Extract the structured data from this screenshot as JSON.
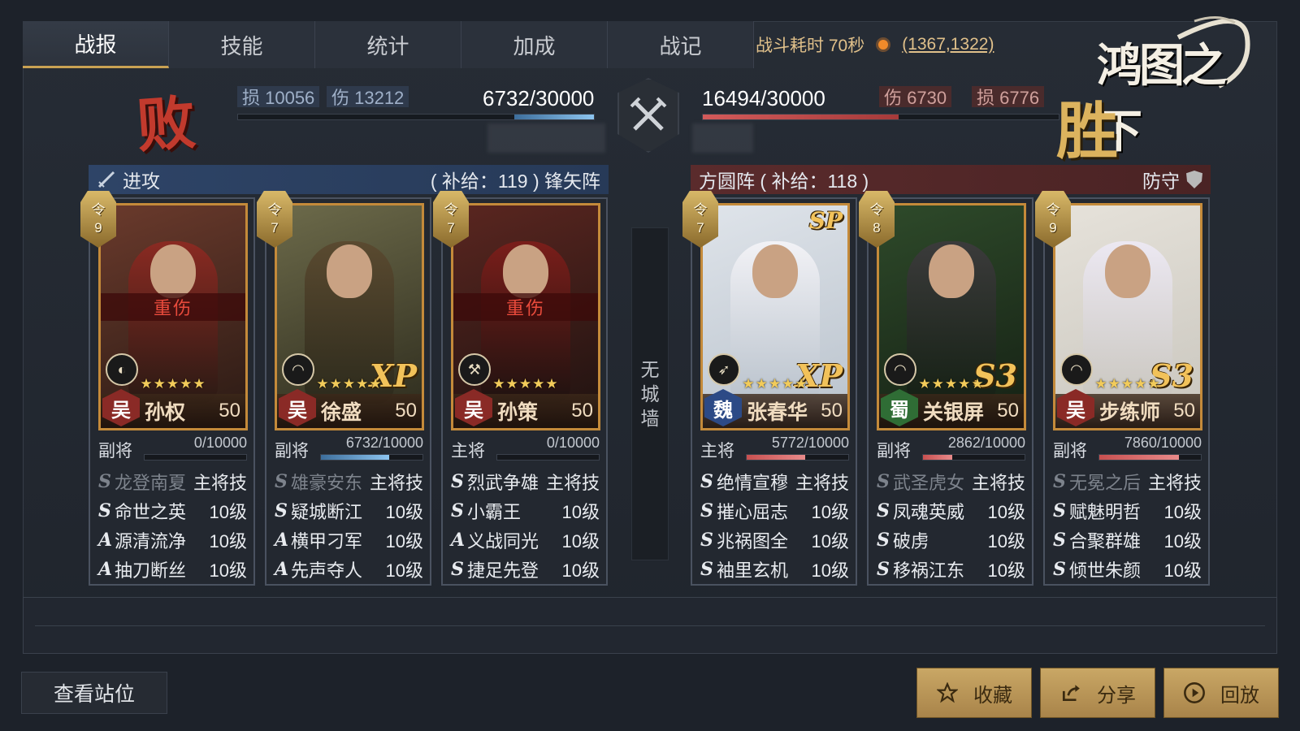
{
  "tabs": [
    "战报",
    "技能",
    "统计",
    "加成",
    "战记"
  ],
  "battle_time": "战斗耗时 70秒",
  "coords": "(1367,1322)",
  "logo_text": "鸿图之下",
  "left": {
    "result": "败",
    "loss_label": "损 10056",
    "dmg_label": "伤 13212",
    "troops": "6732/30000",
    "troops_fraction": 0.2244,
    "header_label": "进攻",
    "supply": "( 补给：119 ) 锋矢阵"
  },
  "right": {
    "result": "胜",
    "dmg_label": "伤  6730",
    "loss_label": "损  6776",
    "troops": "16494/30000",
    "troops_fraction": 0.5498,
    "header_label": "防守",
    "supply": "方圆阵 ( 补给：118 )"
  },
  "wall_text": [
    "无",
    "城",
    "墙"
  ],
  "heroes": [
    {
      "rank_label": "令",
      "rank": "9",
      "faction": "吴",
      "faction_class": "wu",
      "name": "孙权",
      "level": "50",
      "injured": "重伤",
      "badge": "",
      "troop_icon": "shield-icon",
      "role": "副将",
      "hp": "0/10000",
      "hp_fraction": 0,
      "bar": "hp-blue",
      "skills": [
        {
          "grade": "S",
          "name": "龙登南夏",
          "lvl": "主将技",
          "dim": true
        },
        {
          "grade": "S",
          "name": "命世之英",
          "lvl": "10级",
          "dim": false
        },
        {
          "grade": "A",
          "name": "源清流净",
          "lvl": "10级",
          "dim": false
        },
        {
          "grade": "A",
          "name": "抽刀断丝",
          "lvl": "10级",
          "dim": false
        }
      ]
    },
    {
      "rank_label": "令",
      "rank": "7",
      "faction": "吴",
      "faction_class": "wu",
      "name": "徐盛",
      "level": "50",
      "injured": "",
      "badge": "XP",
      "troop_icon": "bow-icon",
      "role": "副将",
      "hp": "6732/10000",
      "hp_fraction": 0.6732,
      "bar": "hp-blue",
      "skills": [
        {
          "grade": "S",
          "name": "雄豪安东",
          "lvl": "主将技",
          "dim": true
        },
        {
          "grade": "S",
          "name": "疑城断江",
          "lvl": "10级",
          "dim": false
        },
        {
          "grade": "A",
          "name": "横甲刁军",
          "lvl": "10级",
          "dim": false
        },
        {
          "grade": "A",
          "name": "先声夺人",
          "lvl": "10级",
          "dim": false
        }
      ]
    },
    {
      "rank_label": "令",
      "rank": "7",
      "faction": "吴",
      "faction_class": "wu",
      "name": "孙策",
      "level": "50",
      "injured": "重伤",
      "badge": "",
      "troop_icon": "axe-icon",
      "role": "主将",
      "hp": "0/10000",
      "hp_fraction": 0,
      "bar": "hp-blue",
      "skills": [
        {
          "grade": "S",
          "name": "烈武争雄",
          "lvl": "主将技",
          "dim": false
        },
        {
          "grade": "S",
          "name": "小霸王",
          "lvl": "10级",
          "dim": false
        },
        {
          "grade": "A",
          "name": "义战同光",
          "lvl": "10级",
          "dim": false
        },
        {
          "grade": "S",
          "name": "捷足先登",
          "lvl": "10级",
          "dim": false
        }
      ]
    },
    {
      "rank_label": "令",
      "rank": "7",
      "faction": "魏",
      "faction_class": "wei",
      "name": "张春华",
      "level": "50",
      "injured": "",
      "badge": "XP",
      "badge_top": "SP",
      "troop_icon": "spear-icon",
      "role": "主将",
      "hp": "5772/10000",
      "hp_fraction": 0.5772,
      "bar": "hp-red",
      "skills": [
        {
          "grade": "S",
          "name": "绝情宣穆",
          "lvl": "主将技",
          "dim": false
        },
        {
          "grade": "S",
          "name": "摧心屈志",
          "lvl": "10级",
          "dim": false
        },
        {
          "grade": "S",
          "name": "兆祸图全",
          "lvl": "10级",
          "dim": false
        },
        {
          "grade": "S",
          "name": "袖里玄机",
          "lvl": "10级",
          "dim": false
        }
      ]
    },
    {
      "rank_label": "令",
      "rank": "8",
      "faction": "蜀",
      "faction_class": "shu",
      "name": "关银屏",
      "level": "50",
      "injured": "",
      "badge": "S3",
      "troop_icon": "bow-icon",
      "role": "副将",
      "hp": "2862/10000",
      "hp_fraction": 0.2862,
      "bar": "hp-red",
      "skills": [
        {
          "grade": "S",
          "name": "武圣虎女",
          "lvl": "主将技",
          "dim": true
        },
        {
          "grade": "S",
          "name": "凤魂英威",
          "lvl": "10级",
          "dim": false
        },
        {
          "grade": "S",
          "name": "破虏",
          "lvl": "10级",
          "dim": false
        },
        {
          "grade": "S",
          "name": "移祸江东",
          "lvl": "10级",
          "dim": false
        }
      ]
    },
    {
      "rank_label": "令",
      "rank": "9",
      "faction": "吴",
      "faction_class": "wu",
      "name": "步练师",
      "level": "50",
      "injured": "",
      "badge": "S3",
      "troop_icon": "bow-icon",
      "role": "副将",
      "hp": "7860/10000",
      "hp_fraction": 0.786,
      "bar": "hp-red",
      "skills": [
        {
          "grade": "S",
          "name": "无冕之后",
          "lvl": "主将技",
          "dim": true
        },
        {
          "grade": "S",
          "name": "赋魅明哲",
          "lvl": "10级",
          "dim": false
        },
        {
          "grade": "S",
          "name": "合聚群雄",
          "lvl": "10级",
          "dim": false
        },
        {
          "grade": "S",
          "name": "倾世朱颜",
          "lvl": "10级",
          "dim": false
        }
      ]
    }
  ],
  "buttons": {
    "view_position": "查看站位",
    "favorite": "收藏",
    "share": "分享",
    "replay": "回放"
  }
}
